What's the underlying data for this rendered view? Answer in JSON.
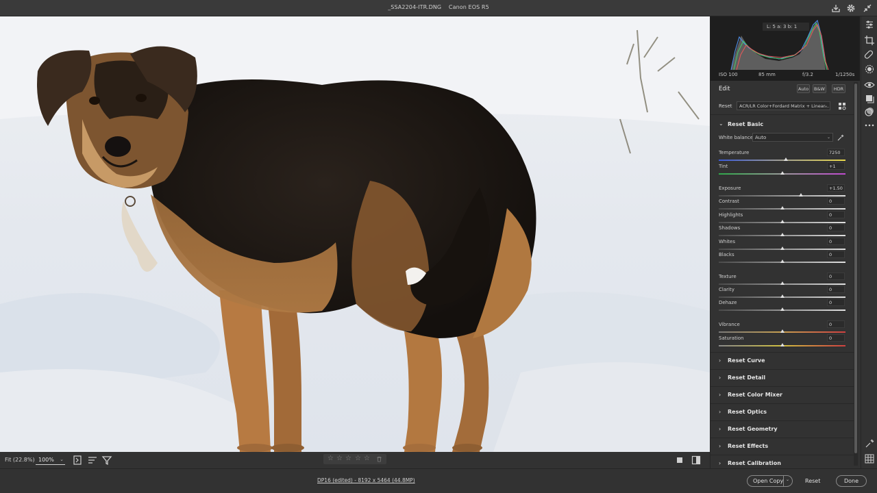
{
  "titlebar": {
    "filename": "_SSA2204-ITR.DNG",
    "camera": "Canon EOS R5"
  },
  "histogram": {
    "lab": "L: 5   a: 3   b: 1",
    "exif": {
      "iso": "ISO 100",
      "focal": "85 mm",
      "aperture": "f/3.2",
      "shutter": "1/1250s"
    }
  },
  "edit": {
    "title": "Edit",
    "buttons": {
      "auto": "Auto",
      "bw": "B&W",
      "hdr": "HDR"
    },
    "profile_label": "Reset",
    "profile_value": "ACR/LR Color+Fordard Matrix + Linear..."
  },
  "basic": {
    "title": "Reset Basic",
    "white_balance_label": "White balance",
    "white_balance_value": "Auto",
    "sliders": [
      {
        "label": "Temperature",
        "value": "7250",
        "position": 0.53,
        "track": "temperature"
      },
      {
        "label": "Tint",
        "value": "+1",
        "position": 0.5,
        "track": "tint"
      },
      {
        "label": "Exposure",
        "value": "+1.50",
        "position": 0.65,
        "track": "neutral"
      },
      {
        "label": "Contrast",
        "value": "0",
        "position": 0.5,
        "track": "neutral"
      },
      {
        "label": "Highlights",
        "value": "0",
        "position": 0.5,
        "track": "neutral"
      },
      {
        "label": "Shadows",
        "value": "0",
        "position": 0.5,
        "track": "neutral"
      },
      {
        "label": "Whites",
        "value": "0",
        "position": 0.5,
        "track": "neutral"
      },
      {
        "label": "Blacks",
        "value": "0",
        "position": 0.5,
        "track": "neutral"
      },
      {
        "label": "Texture",
        "value": "0",
        "position": 0.5,
        "track": "neutral"
      },
      {
        "label": "Clarity",
        "value": "0",
        "position": 0.5,
        "track": "neutral"
      },
      {
        "label": "Dehaze",
        "value": "0",
        "position": 0.5,
        "track": "neutral"
      },
      {
        "label": "Vibrance",
        "value": "0",
        "position": 0.5,
        "track": "vibrance"
      },
      {
        "label": "Saturation",
        "value": "0",
        "position": 0.5,
        "track": "saturation"
      }
    ]
  },
  "sections": [
    "Reset Curve",
    "Reset Detail",
    "Reset Color Mixer",
    "Reset Optics",
    "Reset Geometry",
    "Reset Effects",
    "Reset Calibration"
  ],
  "filmbar": {
    "fit_label": "Fit (22.8%)",
    "zoom_value": "100%"
  },
  "statusbar": {
    "file_info": "DP16 (edited) - 8192 x 5464 (44.8MP)",
    "open_copy": "Open Copy",
    "reset": "Reset",
    "done": "Done"
  },
  "colors": {
    "accent_temperature_start": "#3a5ad8",
    "accent_temperature_end": "#e8d84a",
    "accent_tint_start": "#2fa84a",
    "accent_tint_end": "#c04ad0"
  }
}
